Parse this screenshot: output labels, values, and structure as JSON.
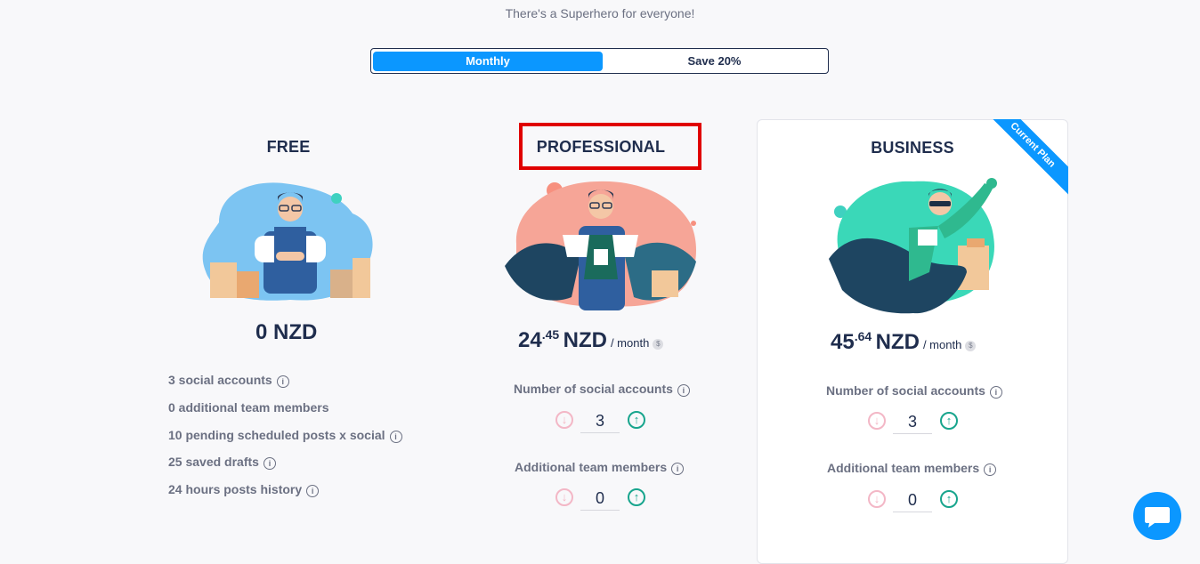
{
  "header": {
    "subtitle": "There's a Superhero for everyone!"
  },
  "billing_toggle": {
    "monthly_label": "Monthly",
    "save_label": "Save 20%",
    "selected": "Monthly"
  },
  "plans": {
    "free": {
      "title": "FREE",
      "price": "0 NZD",
      "features": [
        "3 social accounts",
        "0 additional team members",
        "10 pending scheduled posts x social",
        "25 saved drafts",
        "24 hours posts history"
      ]
    },
    "professional": {
      "title": "PROFESSIONAL",
      "price_whole": "24",
      "price_cents": ".45",
      "currency": "NZD",
      "period": "/ month",
      "social_label": "Number of social accounts",
      "social_value": "3",
      "team_label": "Additional team members",
      "team_value": "0"
    },
    "business": {
      "title": "BUSINESS",
      "ribbon": "Current Plan",
      "price_whole": "45",
      "price_cents": ".64",
      "currency": "NZD",
      "period": "/ month",
      "social_label": "Number of social accounts",
      "social_value": "3",
      "team_label": "Additional team members",
      "team_value": "0"
    }
  },
  "icons": {
    "info": "i",
    "dollar": "$",
    "down": "↓",
    "up": "↑"
  },
  "colors": {
    "accent": "#0b97ff",
    "title": "#1f2d4d",
    "muted": "#6b7082",
    "highlight": "#e00000",
    "up_green": "#18a58d",
    "down_pink": "#f3b7c6"
  }
}
